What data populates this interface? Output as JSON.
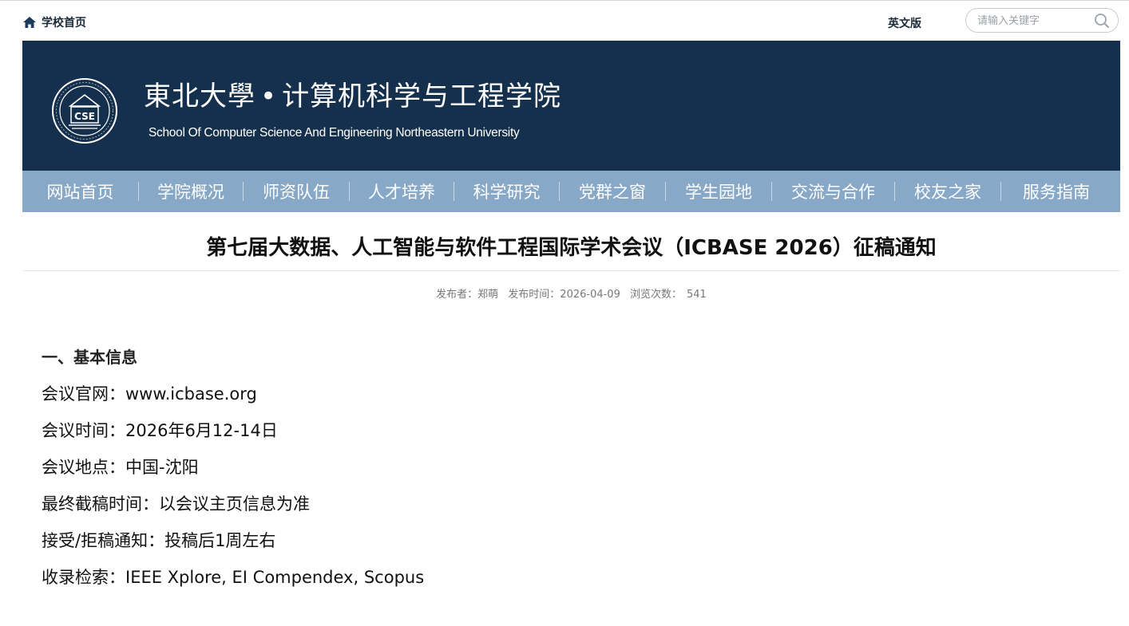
{
  "topbar": {
    "home_label": "学校首页",
    "home_icon": "home-icon",
    "lang_label": "英文版",
    "search_placeholder": "请输入关键字",
    "search_icon": "search-icon"
  },
  "banner": {
    "logo_icon": "university-seal-icon",
    "logo_text": "CSE",
    "name_cn_university": "東北大學",
    "name_cn_dot": "•",
    "name_cn_school": "计算机科学与工程学院",
    "name_en": "School Of Computer Science And Engineering Northeastern University",
    "background_color": "#15304d"
  },
  "nav": {
    "background_color": "#88a8c8",
    "items": [
      {
        "label": "网站首页"
      },
      {
        "label": "学院概况"
      },
      {
        "label": "师资队伍"
      },
      {
        "label": "人才培养"
      },
      {
        "label": "科学研究"
      },
      {
        "label": "党群之窗"
      },
      {
        "label": "学生园地"
      },
      {
        "label": "交流与合作"
      },
      {
        "label": "校友之家"
      },
      {
        "label": "服务指南"
      }
    ]
  },
  "article": {
    "title": "第七届大数据、人工智能与软件工程国际学术会议（ICBASE 2026）征稿通知",
    "meta": {
      "publisher": "发布者：郑萌",
      "publish_time": "发布时间：2026-04-09",
      "views_label": "浏览次数：",
      "views_value": "541"
    },
    "section_heading": "一、基本信息",
    "lines": [
      "会议官网：www.icbase.org",
      "会议时间：2026年6月12-14日",
      "会议地点：中国-沈阳",
      "最终截稿时间：以会议主页信息为准",
      "接受/拒稿通知：投稿后1周左右",
      "收录检索：IEEE Xplore, EI Compendex, Scopus"
    ]
  }
}
